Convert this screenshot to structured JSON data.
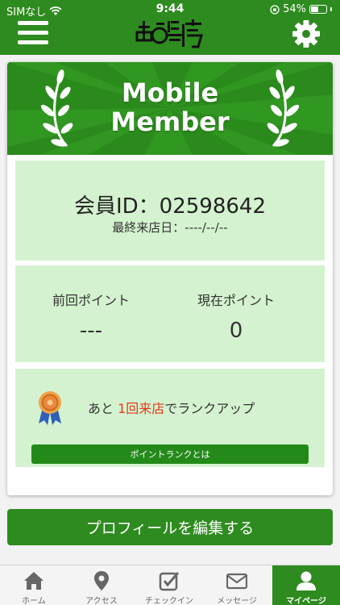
{
  "status_bar": {
    "carrier": "SIMなし",
    "time": "9:44",
    "battery_percent": "54%",
    "battery_level": 0.54
  },
  "header": {
    "menu_icon": "hamburger-icon",
    "logo_icon": "clinic-logo",
    "settings_icon": "gear-icon"
  },
  "card": {
    "banner_title_line1": "Mobile",
    "banner_title_line2": "Member",
    "member_id": "会員ID：02598642",
    "last_visit": "最終来店日：----/--/--",
    "points": {
      "previous_label": "前回ポイント",
      "previous_value": "---",
      "current_label": "現在ポイント",
      "current_value": "0"
    },
    "rank": {
      "msg_prefix": "あと",
      "msg_highlight": "1回来店",
      "msg_suffix": "でランクアップ",
      "button_label": "ポイントランクとは"
    }
  },
  "edit_profile_label": "プロフィールを編集する",
  "tabs": [
    {
      "label": "ホーム",
      "icon": "home-icon"
    },
    {
      "label": "アクセス",
      "icon": "map-pin-icon"
    },
    {
      "label": "チェックイン",
      "icon": "checkin-icon"
    },
    {
      "label": "メッセージ",
      "icon": "mail-icon"
    },
    {
      "label": "マイページ",
      "icon": "user-icon"
    }
  ],
  "colors": {
    "brand_green": "#2e8b1f",
    "panel_green": "#d4f2cf",
    "highlight_red": "#e03a1e"
  }
}
